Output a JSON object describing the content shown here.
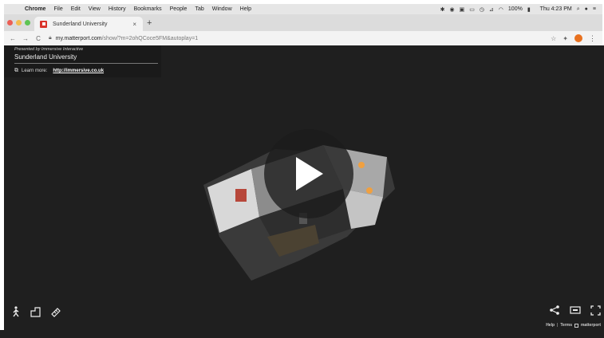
{
  "menubar": {
    "apple": "",
    "items": [
      "Chrome",
      "File",
      "Edit",
      "View",
      "History",
      "Bookmarks",
      "People",
      "Tab",
      "Window",
      "Help"
    ],
    "battery": "100%",
    "clock": "Thu 4:23 PM"
  },
  "browser": {
    "tab_title": "Sunderland University",
    "tab_close": "×",
    "new_tab": "+",
    "url_domain": "my.matterport.com",
    "url_path": "/show/?m=2ohQCoce5FM&autoplay=1",
    "back": "←",
    "forward": "→",
    "reload": "C"
  },
  "viewer": {
    "presented_by": "Presented by Immersive Interactive",
    "space_name": "Sunderland University",
    "learn_more_label": "Learn more:",
    "learn_more_link": "http://immersive.co.uk",
    "footer": {
      "help": "Help",
      "sep": "|",
      "terms": "Terms",
      "brand": "matterport"
    }
  },
  "colors": {
    "viewer_bg": "#1f1f1f",
    "play_bg": "#1c1c1c",
    "favicon": "#d9332b",
    "profile": "#e8711f"
  }
}
